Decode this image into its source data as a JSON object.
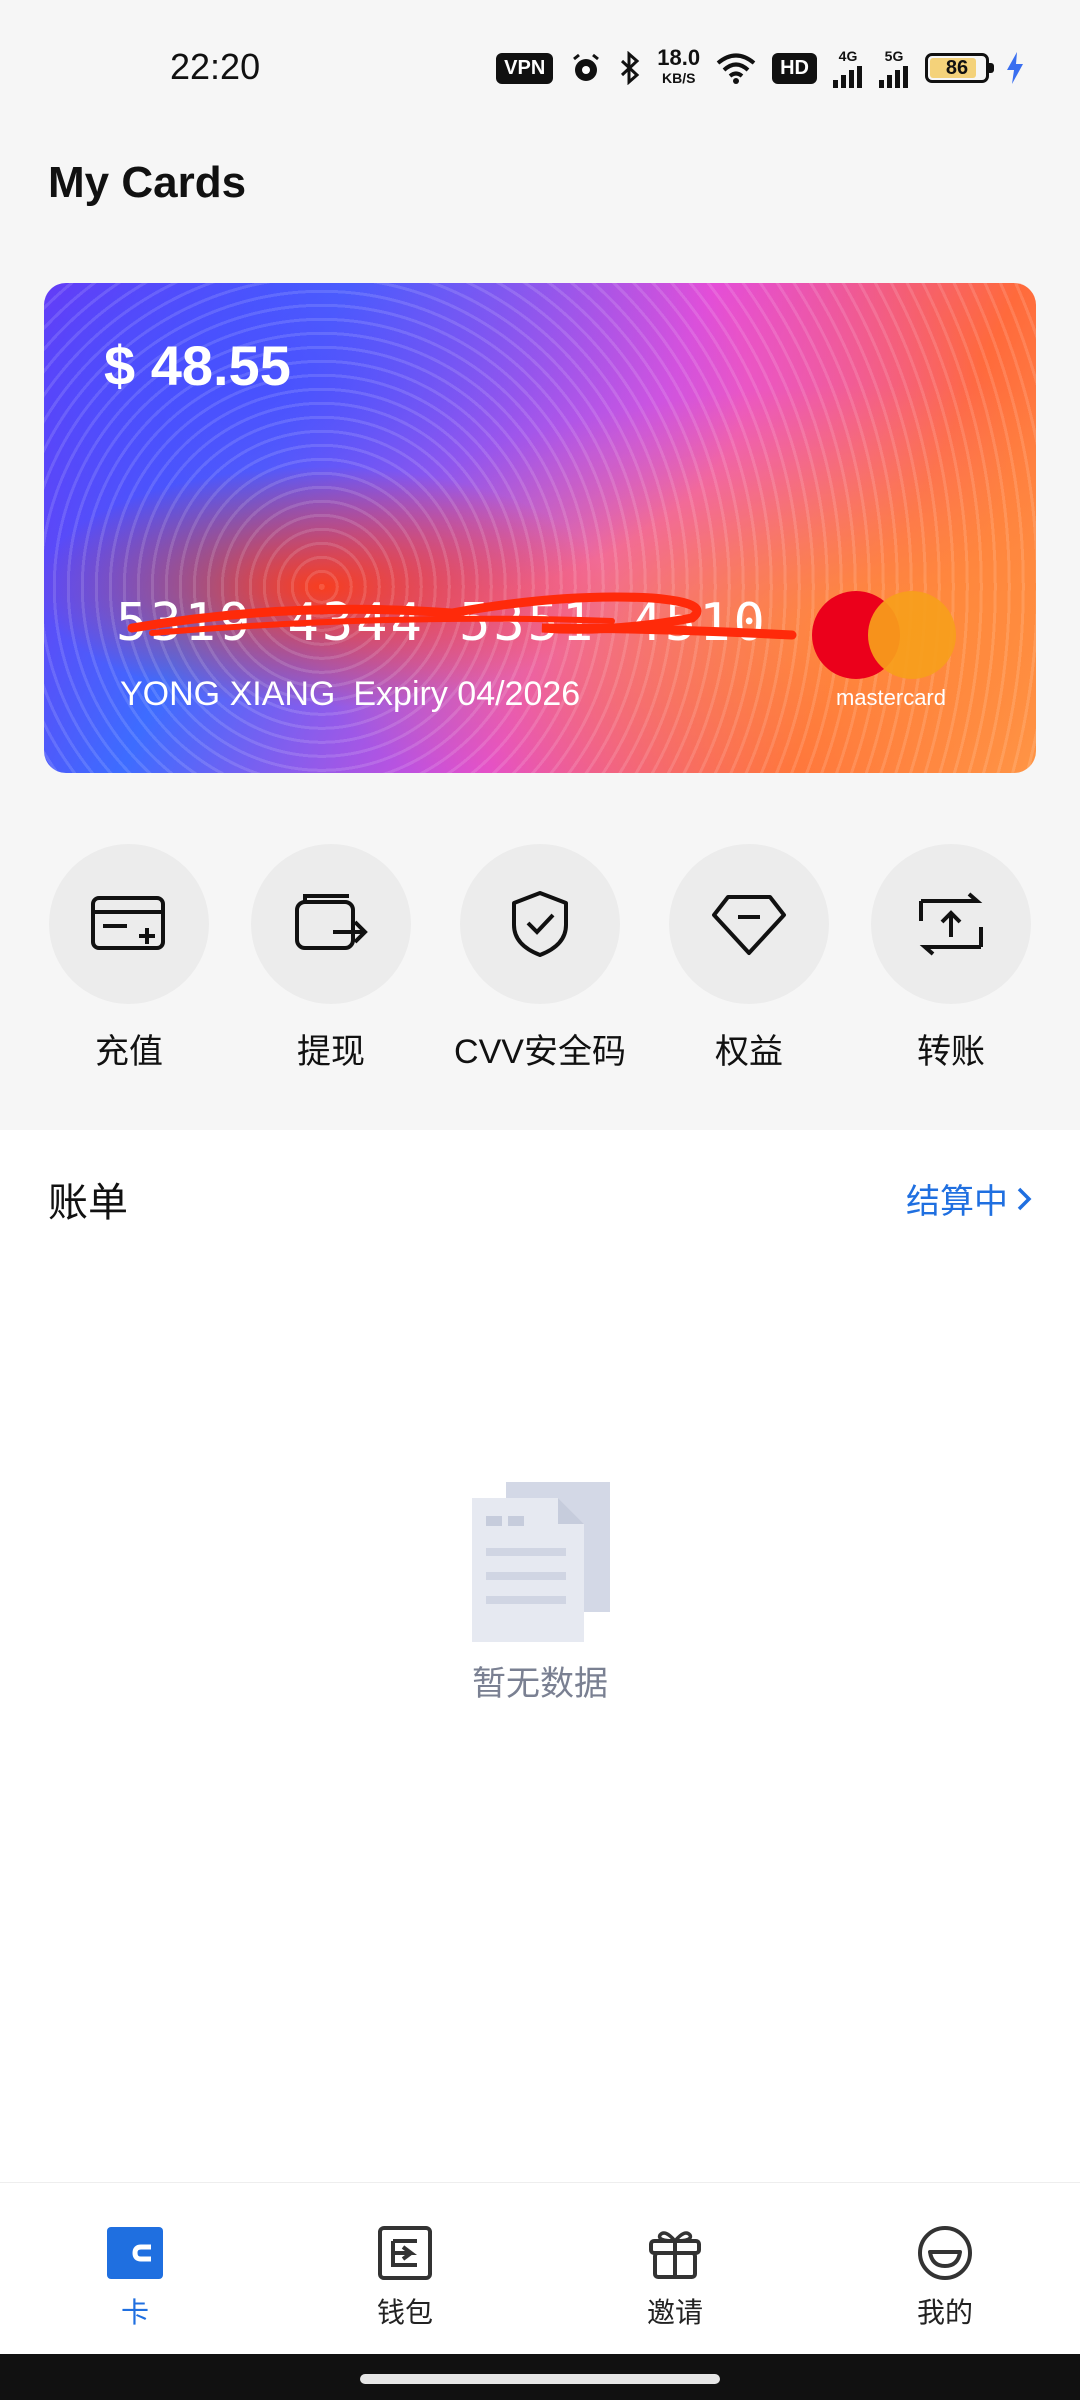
{
  "status_bar": {
    "time": "22:20",
    "vpn": "VPN",
    "speed_value": "18.0",
    "speed_unit": "KB/S",
    "hd": "HD",
    "net1": "4G",
    "net2": "5G",
    "battery": "86",
    "battery_level": 0.86
  },
  "page": {
    "title": "My Cards"
  },
  "card": {
    "balance": "$ 48.55",
    "number": "5319 4344 5351 4510",
    "holder": "YONG XIANG",
    "expiry": "Expiry 04/2026",
    "brand": "mastercard"
  },
  "actions": [
    {
      "label": "充值",
      "icon": "card-add-icon"
    },
    {
      "label": "提现",
      "icon": "wallet-withdraw-icon"
    },
    {
      "label": "CVV安全码",
      "icon": "shield-check-icon"
    },
    {
      "label": "权益",
      "icon": "diamond-icon"
    },
    {
      "label": "转账",
      "icon": "transfer-icon"
    }
  ],
  "bills": {
    "title": "账单",
    "status": "结算中",
    "empty_text": "暂无数据"
  },
  "bottom_nav": {
    "items": [
      {
        "label": "卡",
        "icon": "card-icon",
        "active": true
      },
      {
        "label": "钱包",
        "icon": "wallet-icon",
        "active": false
      },
      {
        "label": "邀请",
        "icon": "gift-icon",
        "active": false
      },
      {
        "label": "我的",
        "icon": "profile-smile-icon",
        "active": false
      }
    ]
  },
  "colors": {
    "accent": "#1f6fe0",
    "mc_red": "#eb001b",
    "mc_yellow": "#f79e1b"
  }
}
